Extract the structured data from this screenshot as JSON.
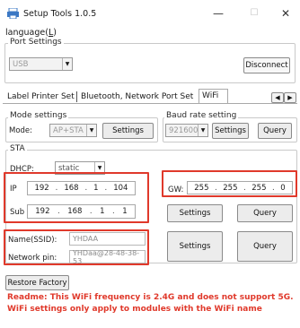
{
  "window": {
    "title": "Setup Tools 1.0.5",
    "minimize": "—",
    "maximize": "☐",
    "close": "✕"
  },
  "menu": {
    "language_label": "language(",
    "language_accel": "L",
    "language_end": ")"
  },
  "port_settings": {
    "title": "Port Settings",
    "port_value": "USB",
    "disconnect_label": "Disconnect"
  },
  "tabs": {
    "items": [
      "Label Printer Set",
      "Bluetooth, Network Port Set",
      "WiFi"
    ],
    "active": "WiFi",
    "scroll_left": "◀",
    "scroll_right": "▶"
  },
  "mode_settings": {
    "title": "Mode settings",
    "mode_label": "Mode:",
    "mode_value": "AP+STA",
    "settings_label": "Settings"
  },
  "baud_rate": {
    "title": "Baud rate setting",
    "value": "921600",
    "settings_label": "Settings",
    "query_label": "Query"
  },
  "sta": {
    "title": "STA",
    "dhcp_label": "DHCP:",
    "dhcp_value": "static",
    "ip_label": "IP",
    "ip": [
      "192",
      "168",
      "1",
      "104"
    ],
    "subnet_label": "Sub",
    "subnet": [
      "192",
      "168",
      "1",
      "1"
    ],
    "gw_label": "GW:",
    "gw": [
      "255",
      "255",
      "255",
      "0"
    ],
    "settings_label": "Settings",
    "query_label": "Query"
  },
  "wifi": {
    "ssid_label": "Name(SSID):",
    "ssid_value": "YHDAA",
    "pin_label": "Network pin:",
    "pin_value": "YHDaa@28-48-38-53",
    "settings_label": "Settings",
    "query_label": "Query"
  },
  "restore_label": "Restore Factory",
  "readme": "Readme: This WiFi frequency is 2.4G and does not support 5G. WiFi settings only apply to modules with the WiFi name",
  "colors": {
    "highlight": "#e0392b",
    "readme_text": "#e0392b",
    "app_icon": "#3b78c4"
  }
}
